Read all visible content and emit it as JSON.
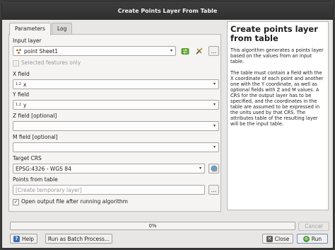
{
  "window": {
    "title": "Create Points Layer From Table"
  },
  "tabs": [
    {
      "label": "Parameters"
    },
    {
      "label": "Log"
    }
  ],
  "params": {
    "input_layer": {
      "label": "Input layer",
      "value": "point Sheet1"
    },
    "selected_only": {
      "label": "Selected features only"
    },
    "x_field": {
      "label": "X field",
      "type_tag": "1.2",
      "value": "x"
    },
    "y_field": {
      "label": "Y field",
      "type_tag": "1.2",
      "value": "y"
    },
    "z_field": {
      "label": "Z field [optional]",
      "value": ""
    },
    "m_field": {
      "label": "M field [optional]",
      "value": ""
    },
    "target_crs": {
      "label": "Target CRS",
      "value": "EPSG:4326 - WGS 84"
    },
    "points_from_table": {
      "label": "Points from table",
      "placeholder": "[Create temporary layer]"
    },
    "open_output": {
      "label": "Open output file after running algorithm",
      "checked_glyph": "✓"
    },
    "browse_label": "..."
  },
  "help": {
    "title": "Create points layer from table",
    "paragraphs": [
      "This algorithm generates a points layer based on the values from an input table.",
      "The table must contain a field with the X coordinate of each point and another one with the Y coordinate, as well as optional fields with Z and M values. A CRS for the output layer has to be specified, and the coordinates in the table are assumed to be expressed in the units used by that CRS. The attributes table of the resulting layer will be the input table."
    ]
  },
  "progress": {
    "text": "0%",
    "value": 0
  },
  "buttons": {
    "cancel": "Cancel",
    "help": "Help",
    "batch": "Run as Batch Process...",
    "close": "Close",
    "run": "Run"
  },
  "icons": {
    "layer": "point-layer-icon",
    "iterate": "iterate-icon",
    "edit": "wrench-pencil-icon",
    "crs": "globe-crs-icon",
    "help": "help-icon",
    "close": "close-icon",
    "run": "run-icon"
  },
  "colors": {
    "accent": "#3a6db5",
    "iterate_green": "#5aa02c",
    "title_bar": "#333333"
  }
}
